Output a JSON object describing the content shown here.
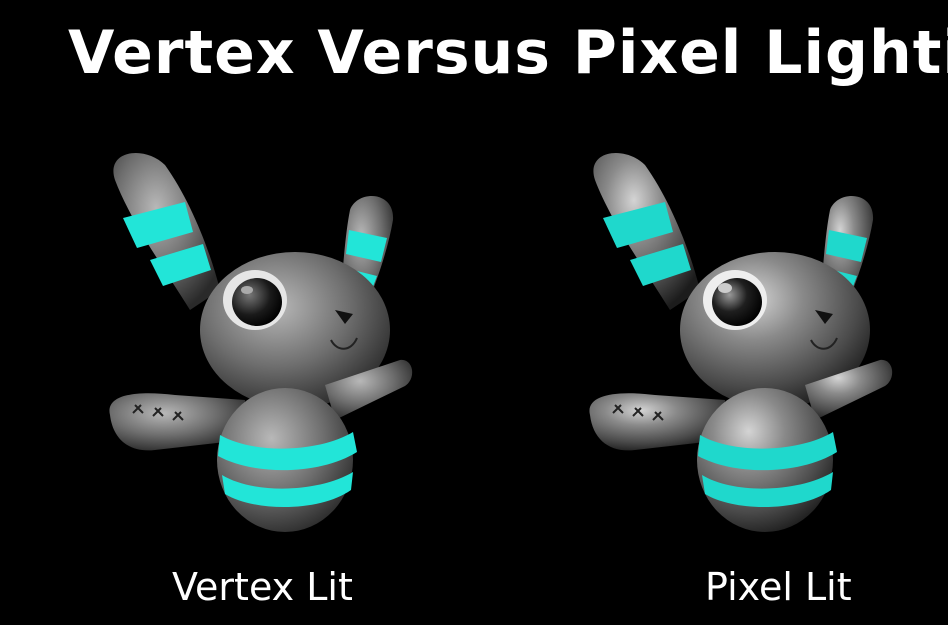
{
  "title": "Vertex Versus Pixel Lighting",
  "panels": [
    {
      "label": "Vertex Lit",
      "shading": "vertex"
    },
    {
      "label": "Pixel Lit",
      "shading": "pixel"
    }
  ],
  "colors": {
    "background": "#000000",
    "text": "#ffffff",
    "glow_stripe": "#22e5d8",
    "fabric": "#6b6b6b"
  }
}
